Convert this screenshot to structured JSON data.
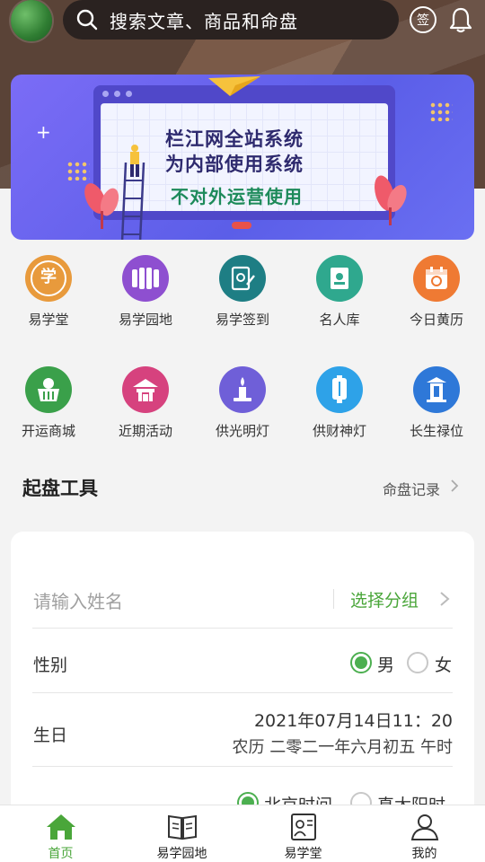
{
  "header": {
    "search_placeholder": "搜索文章、商品和命盘",
    "sign_label": "签"
  },
  "banner": {
    "line1": "栏江网全站系统",
    "line2": "为内部使用系统",
    "line3": "不对外运营使用"
  },
  "grid": {
    "items": [
      {
        "label": "易学堂",
        "icon": "xue-tang-icon",
        "color": "#e89a3c",
        "glyph": "学"
      },
      {
        "label": "易学园地",
        "icon": "garden-icon",
        "color": "#8e4fd0",
        "glyph": "≡"
      },
      {
        "label": "易学签到",
        "icon": "sign-in-icon",
        "color": "#1e7e84",
        "glyph": "✎"
      },
      {
        "label": "名人库",
        "icon": "celebrity-icon",
        "color": "#2fa88e",
        "glyph": "☰"
      },
      {
        "label": "今日黄历",
        "icon": "calendar-icon",
        "color": "#ef7a33",
        "glyph": "◉"
      },
      {
        "label": "开运商城",
        "icon": "shop-icon",
        "color": "#3aa04a",
        "glyph": "☯"
      },
      {
        "label": "近期活动",
        "icon": "activity-icon",
        "color": "#d6427e",
        "glyph": "⌂"
      },
      {
        "label": "供光明灯",
        "icon": "candle-icon",
        "color": "#6f5fd8",
        "glyph": "🕯"
      },
      {
        "label": "供财神灯",
        "icon": "lantern-icon",
        "color": "#2ea2e8",
        "glyph": "▯"
      },
      {
        "label": "长生禄位",
        "icon": "tablet-icon",
        "color": "#2e78d8",
        "glyph": "⛩"
      }
    ]
  },
  "tools": {
    "title": "起盘工具",
    "records_label": "命盘记录"
  },
  "form": {
    "name_placeholder": "请输入姓名",
    "group_label": "选择分组",
    "gender_label": "性别",
    "gender_options": [
      "男",
      "女"
    ],
    "gender_selected": "男",
    "birthday_label": "生日",
    "birthday_value": "2021年07月14日11：20",
    "lunar_value": "农历 二零二一年六月初五 午时",
    "time_options": [
      "北京时间",
      "真太阳时"
    ],
    "time_selected": "北京时间"
  },
  "nav": {
    "items": [
      {
        "label": "首页",
        "icon": "home-icon",
        "active": true
      },
      {
        "label": "易学园地",
        "icon": "book-icon",
        "active": false
      },
      {
        "label": "易学堂",
        "icon": "classroom-icon",
        "active": false
      },
      {
        "label": "我的",
        "icon": "profile-icon",
        "active": false
      }
    ]
  },
  "colors": {
    "accent_green": "#4aa63a",
    "header_brown": "#5a4337"
  }
}
